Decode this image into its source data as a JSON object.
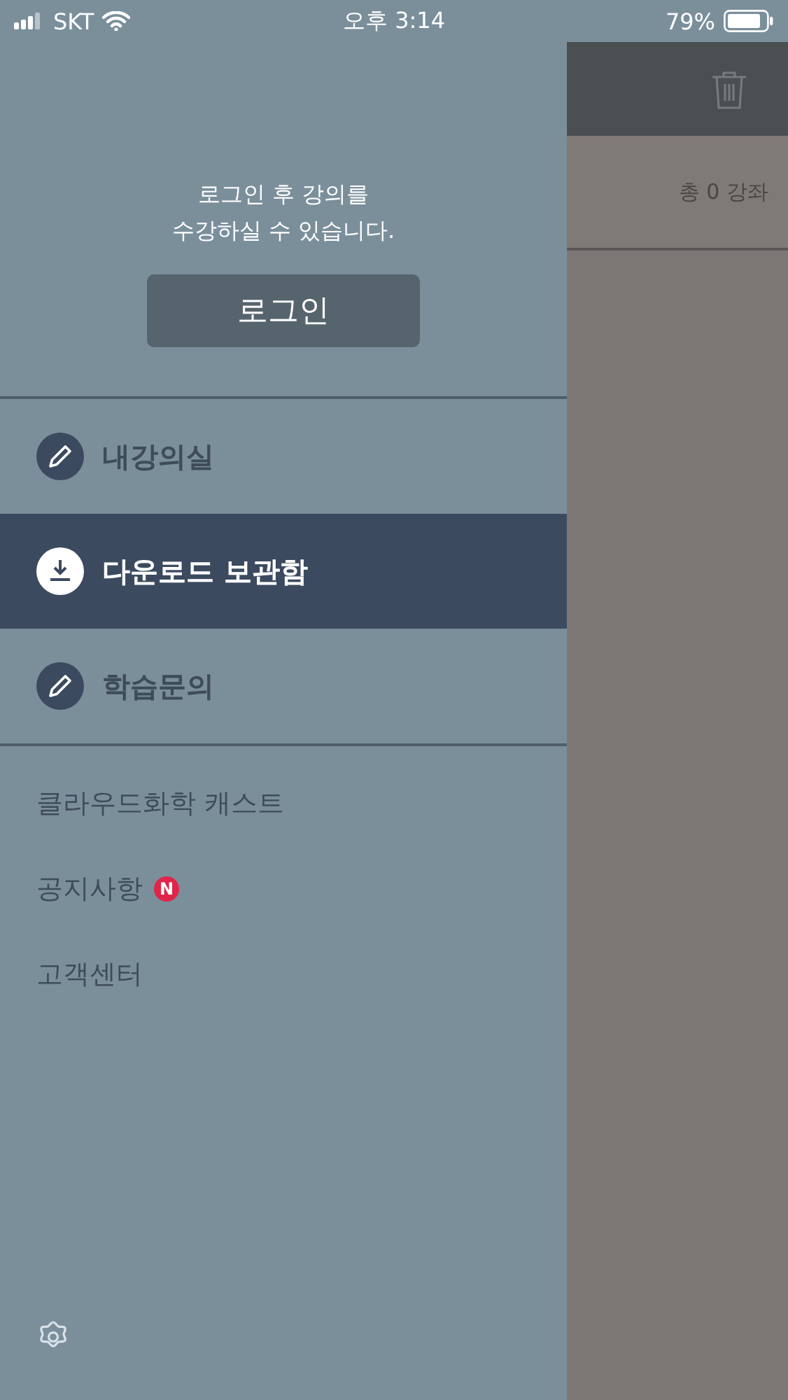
{
  "status_bar": {
    "carrier": "SKT",
    "time": "오후 3:14",
    "battery": "79%"
  },
  "drawer": {
    "login_message": "로그인 후 강의를\n수강하실 수 있습니다.",
    "login_button": "로그인",
    "menu": [
      {
        "label": "내강의실",
        "kind": "pencil",
        "selected": false
      },
      {
        "label": "다운로드 보관함",
        "kind": "download",
        "selected": true
      },
      {
        "label": "학습문의",
        "kind": "pencil",
        "selected": false
      }
    ],
    "links": [
      {
        "label": "클라우드화학 캐스트"
      },
      {
        "label": "공지사항",
        "badge": "N"
      },
      {
        "label": "고객센터"
      }
    ]
  },
  "background_screen": {
    "count_label": "총 0 강좌"
  }
}
